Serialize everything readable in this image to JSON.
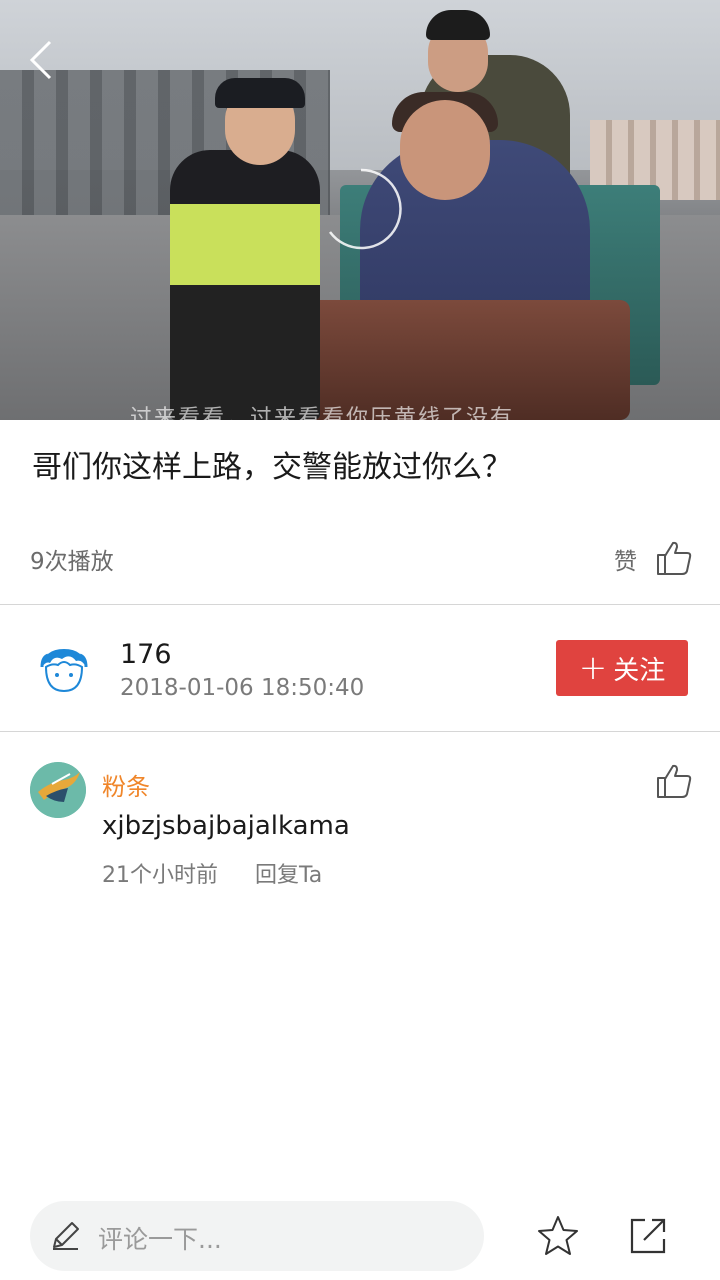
{
  "video": {
    "subtitle": "过来看看，过来看看你压黄线了没有"
  },
  "post": {
    "title": "哥们你这样上路，交警能放过你么？",
    "play_count": "9次播放",
    "like_label": "赞"
  },
  "author": {
    "name": "176",
    "date": "2018-01-06 18:50:40",
    "follow_label": "关注"
  },
  "comment": {
    "user": "粉条",
    "text": "xjbzjsbajbajalkama",
    "time": "21个小时前",
    "reply_label": "回复Ta"
  },
  "bottom_bar": {
    "input_placeholder": "评论一下..."
  },
  "colors": {
    "follow_button": "#e0433f",
    "comment_user": "#f0862a"
  }
}
